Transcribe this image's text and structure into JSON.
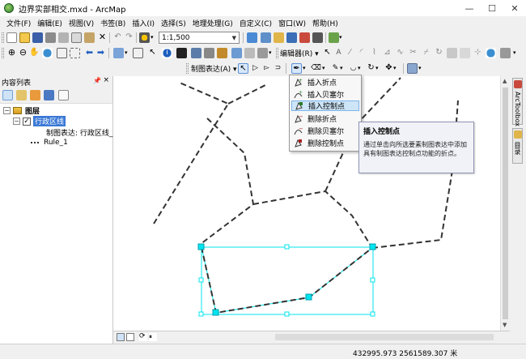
{
  "window": {
    "title": "边界实部相交.mxd - ArcMap"
  },
  "menu": [
    "文件(F)",
    "编辑(E)",
    "视图(V)",
    "书签(B)",
    "插入(I)",
    "选择(S)",
    "地理处理(G)",
    "自定义(C)",
    "窗口(W)",
    "帮助(H)"
  ],
  "toolbar": {
    "scale": "1:1,500",
    "editor_label": "编辑器(R) ▾",
    "representation_label": "制图表达(A) ▾"
  },
  "toc": {
    "title": "内容列表",
    "root": "图层",
    "layer": "行政区线",
    "representation": "制图表达: 行政区线_R",
    "rule": "Rule_1"
  },
  "dropdown": {
    "items": [
      "插入折点",
      "插入贝塞尔",
      "插入控制点",
      "删除折点",
      "删除贝塞尔",
      "删除控制点"
    ],
    "active_index": 2
  },
  "tooltip": {
    "title": "插入控制点",
    "body": "通过单击向所选要素制图表达中添加具有制图表达控制点功能的折点。"
  },
  "dock": {
    "arctoolbox": "ArcToolbox",
    "catalog": "目录"
  },
  "status": {
    "coordinates": "432995.973  2561589.307 米"
  },
  "colors": {
    "selection": "#00e5ee",
    "line": "#333333",
    "highlight": "#cde5f7"
  }
}
